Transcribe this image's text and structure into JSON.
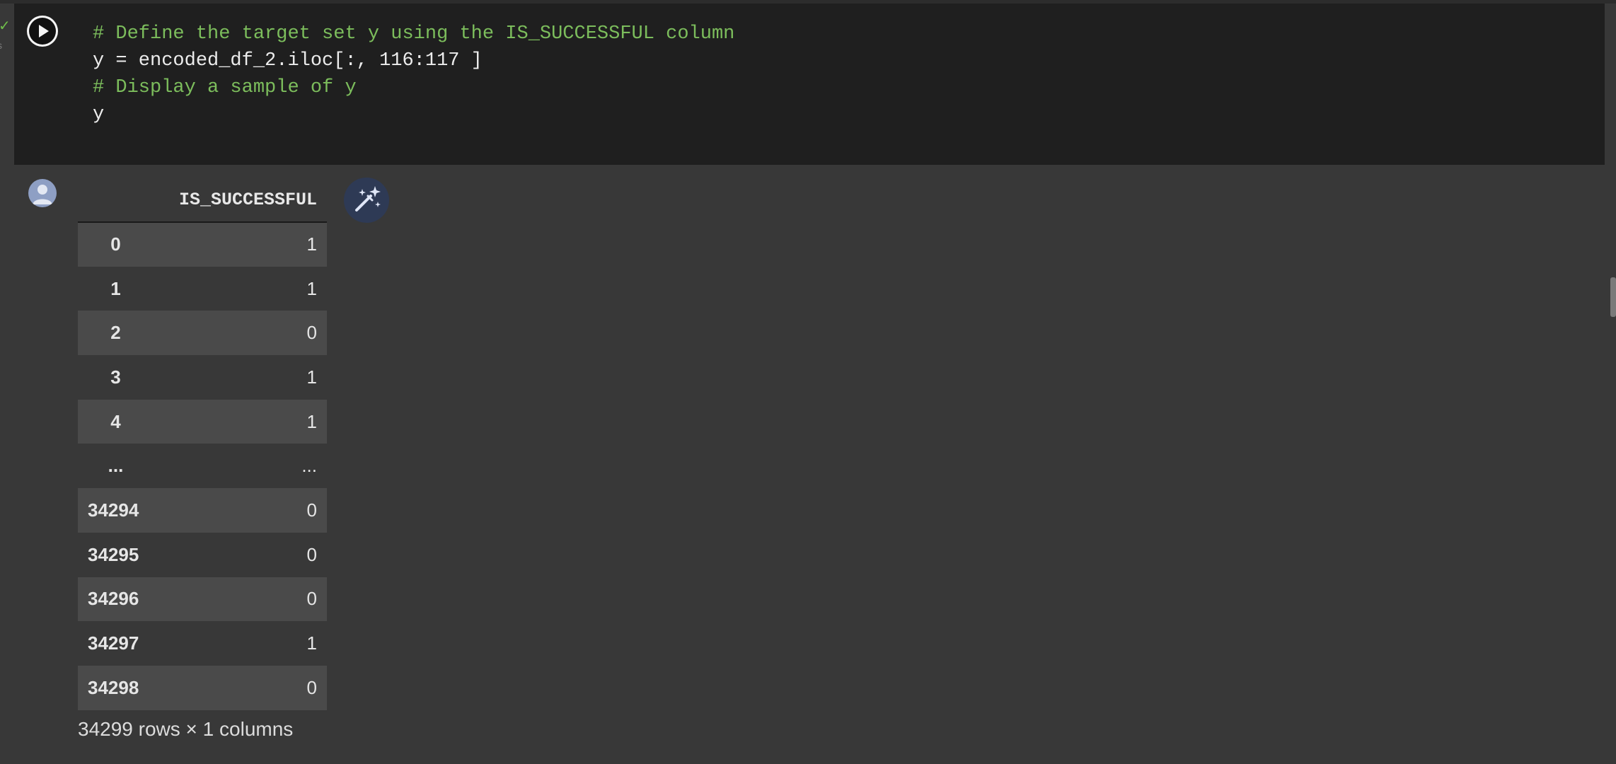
{
  "code_cell": {
    "lines": [
      {
        "text": "# Define the target set y using the IS_SUCCESSFUL column",
        "kind": "comment"
      },
      {
        "text": "y = encoded_df_2.iloc[:, 116:117 ]",
        "kind": "code"
      },
      {
        "text": "# Display a sample of y",
        "kind": "comment"
      },
      {
        "text": "y",
        "kind": "code"
      }
    ],
    "execution": {
      "status_icon": "check-icon",
      "time_text": "s"
    },
    "run_button_icon": "play-icon"
  },
  "output": {
    "avatar_icon": "user-avatar-icon",
    "magic_button_icon": "magic-wand-icon",
    "table": {
      "column": "IS_SUCCESSFUL",
      "rows": [
        {
          "index": "0",
          "value": "1"
        },
        {
          "index": "1",
          "value": "1"
        },
        {
          "index": "2",
          "value": "0"
        },
        {
          "index": "3",
          "value": "1"
        },
        {
          "index": "4",
          "value": "1"
        },
        {
          "index": "...",
          "value": "..."
        },
        {
          "index": "34294",
          "value": "0"
        },
        {
          "index": "34295",
          "value": "0"
        },
        {
          "index": "34296",
          "value": "0"
        },
        {
          "index": "34297",
          "value": "1"
        },
        {
          "index": "34298",
          "value": "0"
        }
      ]
    },
    "footer": "34299 rows × 1 columns"
  },
  "colors": {
    "page_background": "#383838",
    "code_background": "#1f1f1f",
    "comment": "#7cbd5c",
    "stripe": "#4a4a4a"
  }
}
